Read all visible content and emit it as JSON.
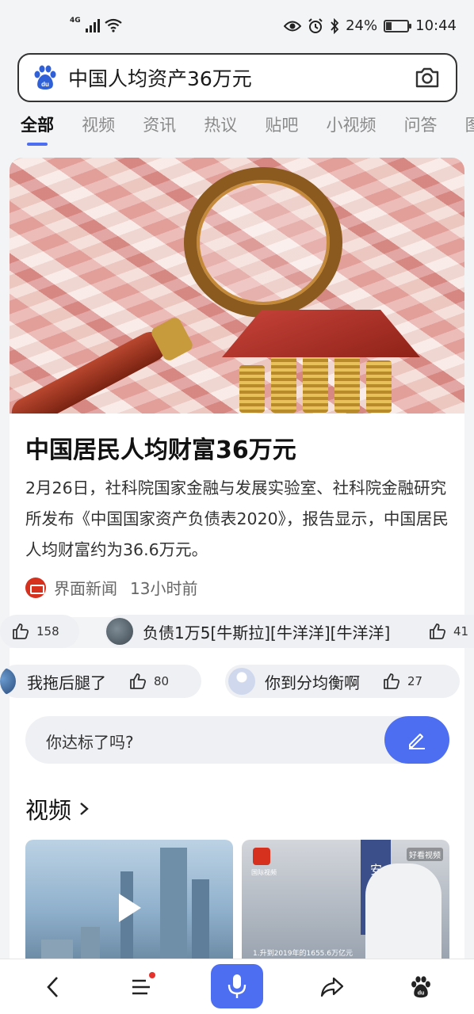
{
  "status_bar": {
    "network": "4G",
    "battery": "24%",
    "time": "10:44"
  },
  "search": {
    "query": "中国人均资产36万元"
  },
  "tabs": [
    {
      "label": "全部",
      "active": true
    },
    {
      "label": "视频"
    },
    {
      "label": "资讯"
    },
    {
      "label": "热议"
    },
    {
      "label": "贴吧"
    },
    {
      "label": "小视频"
    },
    {
      "label": "问答"
    },
    {
      "label": "图"
    }
  ],
  "article": {
    "title": "中国居民人均财富36万元",
    "description": "2月26日，社科院国家金融与发展实验室、社科院金融研究所发布《中国国家资产负债表2020》，报告显示，中国居民人均财富约为36.6万元。",
    "source": "界面新闻",
    "time": "13小时前"
  },
  "comments": {
    "row1": [
      {
        "text": "",
        "likes": "158"
      },
      {
        "text": "负债1万5[牛斯拉][牛洋洋][牛洋洋]",
        "likes": "41"
      }
    ],
    "row2": [
      {
        "text": "我拖后腿了",
        "likes": "80"
      },
      {
        "text": "你到分均衡啊",
        "likes": "27"
      }
    ]
  },
  "ask": {
    "text": "你达标了吗?"
  },
  "videos": {
    "heading": "视频",
    "items": [
      {
        "kind": "skyline"
      },
      {
        "brand": "好看视频",
        "icon_label": "国际视频",
        "station": "安检查站",
        "caption": "1.升到2019年的1655.6万亿元"
      }
    ]
  },
  "colors": {
    "accent": "#4e6ef2",
    "bg": "#f3f4f6"
  }
}
